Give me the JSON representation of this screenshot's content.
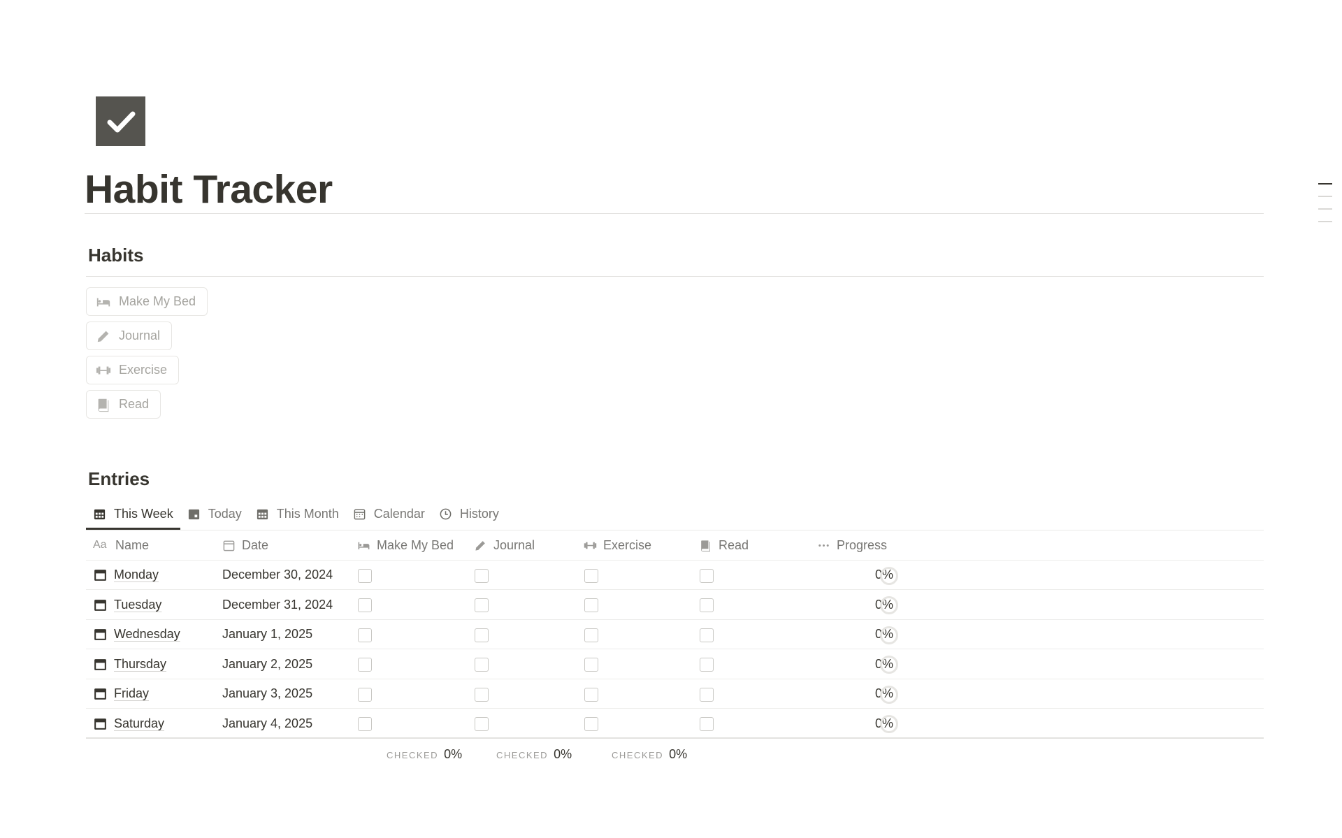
{
  "page": {
    "icon": "checkmark-box-icon",
    "title": "Habit Tracker"
  },
  "habits": {
    "heading": "Habits",
    "buttons": [
      {
        "label": "Make My Bed",
        "icon": "bed-icon"
      },
      {
        "label": "Journal",
        "icon": "pencil-icon"
      },
      {
        "label": "Exercise",
        "icon": "dumbbell-icon"
      },
      {
        "label": "Read",
        "icon": "book-icon"
      }
    ]
  },
  "entries": {
    "heading": "Entries",
    "tabs": [
      {
        "label": "This Week",
        "icon": "calendar-grid-icon",
        "active": true
      },
      {
        "label": "Today",
        "icon": "calendar-day-icon",
        "active": false
      },
      {
        "label": "This Month",
        "icon": "calendar-grid-icon",
        "active": false
      },
      {
        "label": "Calendar",
        "icon": "calendar-icon",
        "active": false
      },
      {
        "label": "History",
        "icon": "clock-icon",
        "active": false
      }
    ],
    "columns": {
      "name": "Name",
      "name_icon_text": "Aa",
      "date": "Date",
      "bed": "Make My Bed",
      "journal": "Journal",
      "exercise": "Exercise",
      "read": "Read",
      "progress": "Progress"
    },
    "rows": [
      {
        "name": "Monday",
        "date": "December 30, 2024",
        "progress": "0%"
      },
      {
        "name": "Tuesday",
        "date": "December 31, 2024",
        "progress": "0%"
      },
      {
        "name": "Wednesday",
        "date": "January 1, 2025",
        "progress": "0%"
      },
      {
        "name": "Thursday",
        "date": "January 2, 2025",
        "progress": "0%"
      },
      {
        "name": "Friday",
        "date": "January 3, 2025",
        "progress": "0%"
      },
      {
        "name": "Saturday",
        "date": "January 4, 2025",
        "progress": "0%"
      }
    ],
    "calculations": [
      {
        "label": "CHECKED",
        "value": "0%"
      },
      {
        "label": "CHECKED",
        "value": "0%"
      },
      {
        "label": "CHECKED",
        "value": "0%"
      }
    ]
  },
  "colors": {
    "text": "#37352f",
    "muted": "#787774",
    "icon_bg": "#55544f",
    "border": "#e3e2e0"
  }
}
